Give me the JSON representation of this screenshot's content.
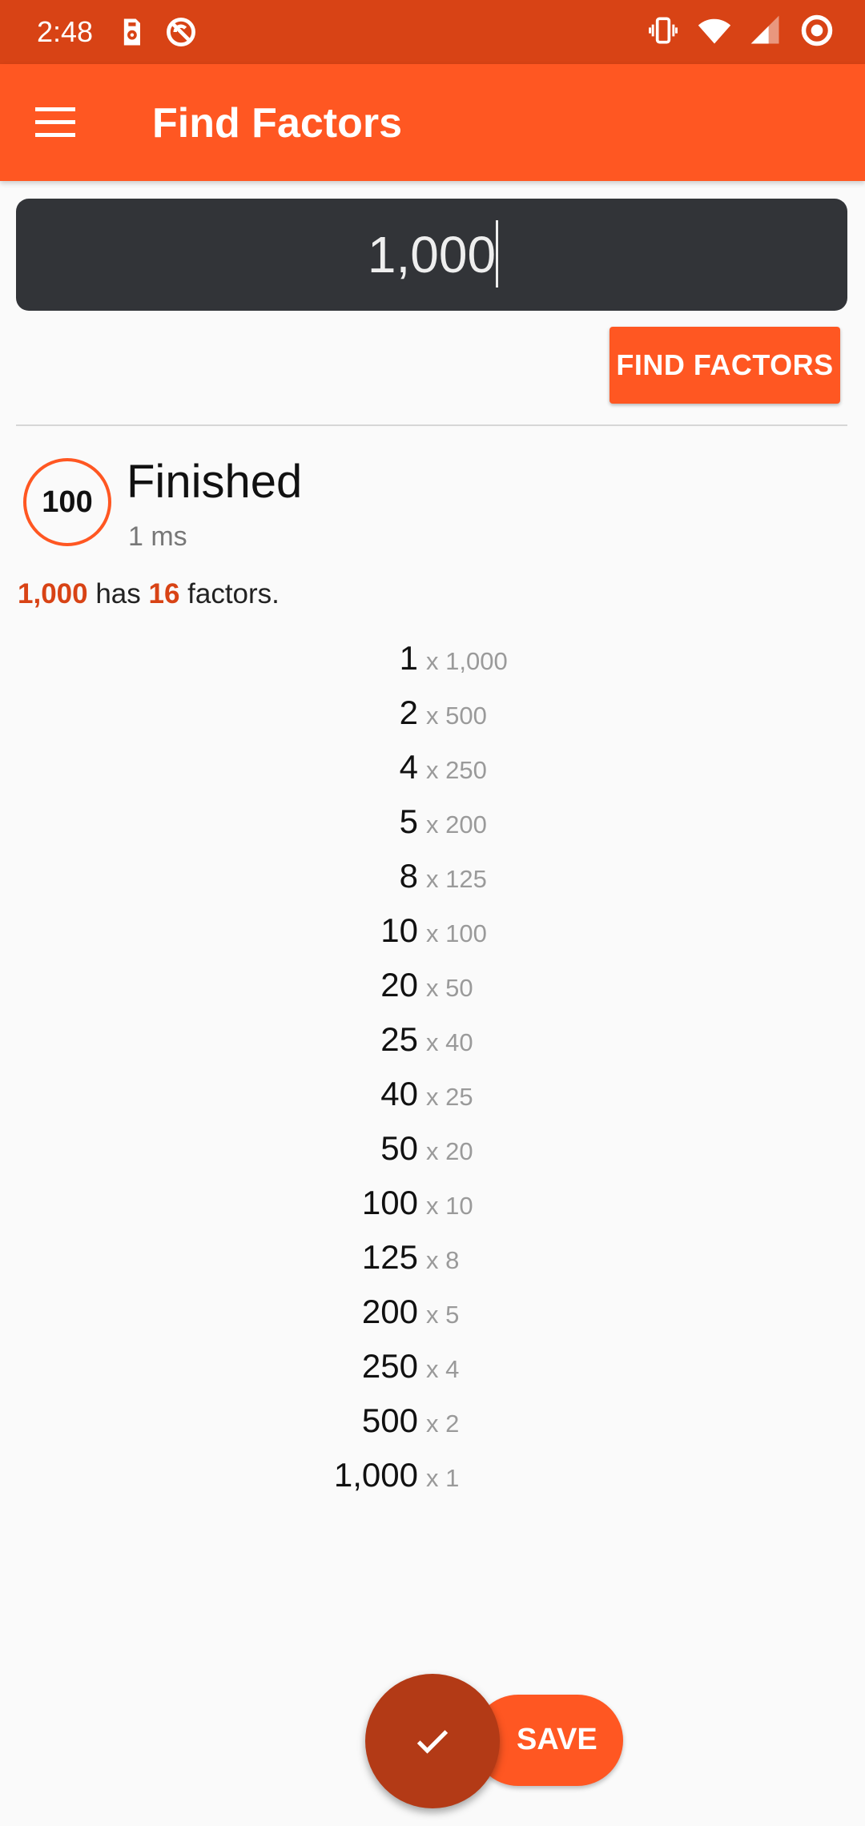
{
  "status_bar": {
    "time": "2:48",
    "icons": [
      "sd-card-icon",
      "no-disturb-icon",
      "vibrate-icon",
      "wifi-icon",
      "cell-signal-icon",
      "record-icon"
    ]
  },
  "app_bar": {
    "title": "Find Factors",
    "menu_icon": "menu-icon"
  },
  "input": {
    "value": "1,000"
  },
  "buttons": {
    "find": "FIND FACTORS",
    "save": "SAVE"
  },
  "status": {
    "progress": "100",
    "title": "Finished",
    "elapsed": "1 ms"
  },
  "summary": {
    "number": "1,000",
    "text_has": " has ",
    "count": "16",
    "text_factors": " factors."
  },
  "factors": [
    {
      "factor": "1",
      "pair": "x 1,000"
    },
    {
      "factor": "2",
      "pair": "x 500"
    },
    {
      "factor": "4",
      "pair": "x 250"
    },
    {
      "factor": "5",
      "pair": "x 200"
    },
    {
      "factor": "8",
      "pair": "x 125"
    },
    {
      "factor": "10",
      "pair": "x 100"
    },
    {
      "factor": "20",
      "pair": "x 50"
    },
    {
      "factor": "25",
      "pair": "x 40"
    },
    {
      "factor": "40",
      "pair": "x 25"
    },
    {
      "factor": "50",
      "pair": "x 20"
    },
    {
      "factor": "100",
      "pair": "x 10"
    },
    {
      "factor": "125",
      "pair": "x 8"
    },
    {
      "factor": "200",
      "pair": "x 5"
    },
    {
      "factor": "250",
      "pair": "x 4"
    },
    {
      "factor": "500",
      "pair": "x 2"
    },
    {
      "factor": "1,000",
      "pair": "x 1"
    }
  ],
  "colors": {
    "status_bar": "#d84315",
    "app_bar": "#ff5722",
    "accent": "#ff5722",
    "highlight_text": "#d84315",
    "fab": "#b33a16",
    "input_bg": "#323438"
  }
}
